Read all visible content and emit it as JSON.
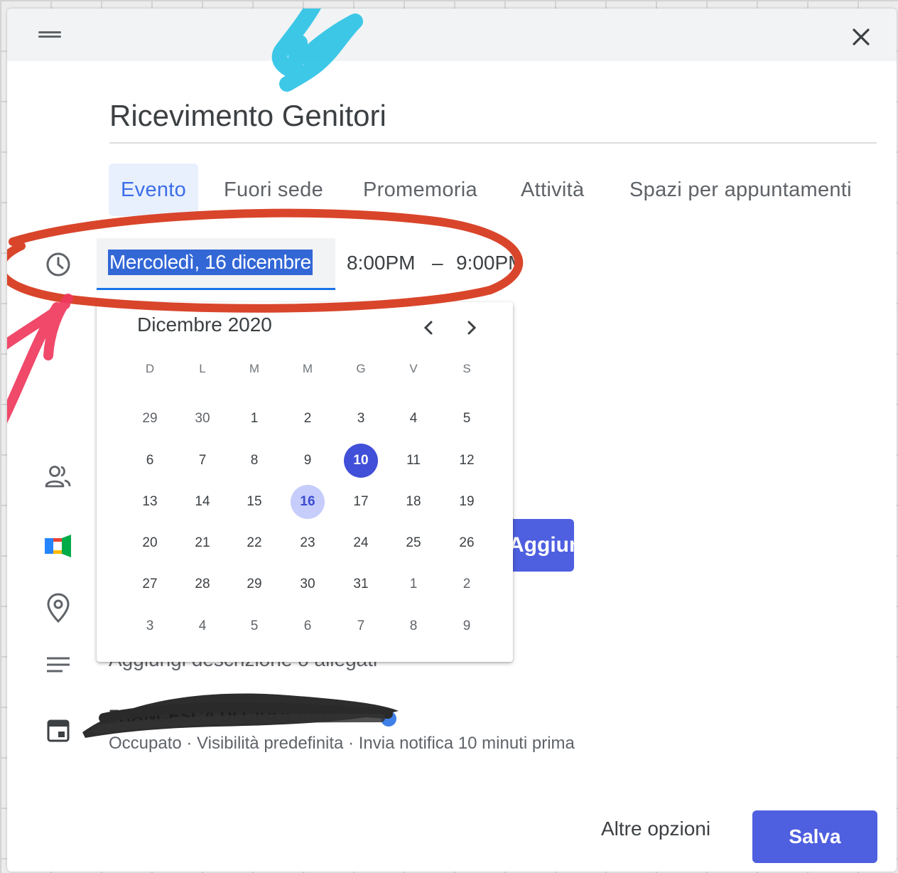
{
  "dialog": {
    "title_value": "Ricevimento Genitori",
    "tabs": [
      {
        "label": "Evento",
        "active": true
      },
      {
        "label": "Fuori sede",
        "active": false
      },
      {
        "label": "Promemoria",
        "active": false
      },
      {
        "label": "Attività",
        "active": false
      },
      {
        "label": "Spazi per appuntamenti",
        "active": false
      }
    ],
    "datetime": {
      "date": "Mercoledì, 16 dicembre",
      "start_time": "8:00PM",
      "separator": "–",
      "end_time": "9:00PM"
    },
    "meet_button_label": "Aggiungi videoconferenza di Google Meet",
    "description_placeholder": "Aggiungi descrizione o allegati",
    "owner_name": "FRANCESCA DI GIROLAMO",
    "status_line": "Occupato · Visibilità predefinita · Invia notifica 10 minuti prima",
    "more_options_label": "Altre opzioni",
    "save_label": "Salva"
  },
  "calendar": {
    "title": "Dicembre 2020",
    "weekdays": [
      "D",
      "L",
      "M",
      "M",
      "G",
      "V",
      "S"
    ],
    "weeks": [
      [
        "29",
        "30",
        "1",
        "2",
        "3",
        "4",
        "5"
      ],
      [
        "6",
        "7",
        "8",
        "9",
        "10",
        "11",
        "12"
      ],
      [
        "13",
        "14",
        "15",
        "16",
        "17",
        "18",
        "19"
      ],
      [
        "20",
        "21",
        "22",
        "23",
        "24",
        "25",
        "26"
      ],
      [
        "27",
        "28",
        "29",
        "30",
        "31",
        "1",
        "2"
      ],
      [
        "3",
        "4",
        "5",
        "6",
        "7",
        "8",
        "9"
      ]
    ],
    "today": "10",
    "selected": "16"
  },
  "icons": {
    "header": [
      "drag-handle-icon",
      "close-icon"
    ],
    "rows": [
      "clock-icon",
      "people-icon",
      "google-meet-icon",
      "location-pin-icon",
      "description-lines-icon",
      "calendar-icon"
    ],
    "calendar_nav": [
      "chevron-left-icon",
      "chevron-right-icon"
    ]
  },
  "colors": {
    "accent": "#4e5fe0",
    "today": "#4150d8",
    "selected": "#c6cdfb",
    "annotation_circle": "#d9452b",
    "annotation_arrow_top": "#2ec3e6",
    "annotation_arrow_left": "#ef3a5d"
  }
}
